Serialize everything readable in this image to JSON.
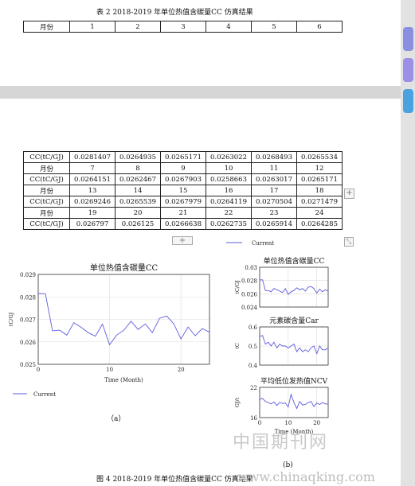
{
  "doc": {
    "table_title": "表 2  2018-2019 年单位热值含碳量CC 仿真结果",
    "header_row": [
      "月份",
      "1",
      "2",
      "3",
      "4",
      "5",
      "6"
    ],
    "rows": [
      [
        "CC(tC/GJ)",
        "0.0281407",
        "0.0264935",
        "0.0265171",
        "0.0263022",
        "0.0268493",
        "0.0265534"
      ],
      [
        "月份",
        "7",
        "8",
        "9",
        "10",
        "11",
        "12"
      ],
      [
        "CC(tC/GJ)",
        "0.0264151",
        "0.0262467",
        "0.0267903",
        "0.0258663",
        "0.0263017",
        "0.0265171"
      ],
      [
        "月份",
        "13",
        "14",
        "15",
        "16",
        "17",
        "18"
      ],
      [
        "CC(tC/GJ)",
        "0.0269246",
        "0.0265539",
        "0.0267979",
        "0.0264119",
        "0.0270504",
        "0.0271479"
      ],
      [
        "月份",
        "19",
        "20",
        "21",
        "22",
        "23",
        "24"
      ],
      [
        "CC(tC/GJ)",
        "0.026797",
        "0.026125",
        "0.0266638",
        "0.0262735",
        "0.0265914",
        "0.0264285"
      ]
    ],
    "label_a": "（a）",
    "label_b": "(b)",
    "figure_caption": "图 4  2018-2019 年单位热值含碳量CC 仿真结果"
  },
  "ui": {
    "add_handle": "+",
    "resize_handle": "⤡",
    "tab_colors": [
      "#8a8fe0",
      "#9b8fe6",
      "#4aa3df"
    ]
  },
  "watermark": {
    "cn": "中国期刊网",
    "url": "www.chinaqking.com"
  },
  "chart_data": [
    {
      "type": "line",
      "title": "单位热值含碳量CC",
      "xlabel": "Time (Month)",
      "ylabel": "tC/GJ",
      "xlim": [
        0,
        24
      ],
      "ylim": [
        0.025,
        0.029
      ],
      "xticks": [
        0,
        10,
        20
      ],
      "yticks": [
        "0.025",
        "0.026",
        "0.027",
        "0.028",
        "0.029"
      ],
      "series": [
        {
          "name": "Current",
          "color": "#5b5bdc",
          "x": [
            0,
            1,
            2,
            3,
            4,
            5,
            6,
            7,
            8,
            9,
            10,
            11,
            12,
            13,
            14,
            15,
            16,
            17,
            18,
            19,
            20,
            21,
            22,
            23,
            24
          ],
          "values": [
            0.02815,
            0.02814,
            0.02649,
            0.02652,
            0.0263,
            0.02685,
            0.02665,
            0.02641,
            0.02625,
            0.02679,
            0.02587,
            0.0263,
            0.02652,
            0.02692,
            0.02655,
            0.0268,
            0.02641,
            0.02705,
            0.02715,
            0.0268,
            0.02613,
            0.02666,
            0.02627,
            0.02659,
            0.02643
          ]
        }
      ],
      "grid": true,
      "legend": "bottom-left"
    },
    {
      "type": "line",
      "title": "单位热值含碳量CC",
      "ylabel": "tC/GJ",
      "xlim": [
        0,
        24
      ],
      "ylim": [
        0.024,
        0.03
      ],
      "yticks": [
        "0.024",
        "0.026",
        "0.028",
        "0.03"
      ],
      "series": [
        {
          "name": "Current",
          "color": "#5b5bdc",
          "x": [
            0,
            1,
            2,
            3,
            4,
            5,
            6,
            7,
            8,
            9,
            10,
            11,
            12,
            13,
            14,
            15,
            16,
            17,
            18,
            19,
            20,
            21,
            22,
            23,
            24
          ],
          "values": [
            0.0281,
            0.0281,
            0.0265,
            0.0265,
            0.0263,
            0.0268,
            0.0266,
            0.0264,
            0.0262,
            0.0268,
            0.0259,
            0.0263,
            0.0265,
            0.0269,
            0.0266,
            0.0268,
            0.0264,
            0.027,
            0.0271,
            0.0268,
            0.0261,
            0.0267,
            0.0263,
            0.0266,
            0.0264
          ]
        }
      ],
      "grid": true,
      "legend": "top"
    },
    {
      "type": "line",
      "title": "元素碳含量Car",
      "ylabel": "tC",
      "xlim": [
        0,
        24
      ],
      "ylim": [
        0.4,
        0.6
      ],
      "yticks": [
        "0.4",
        "0.5",
        "0.6"
      ],
      "series": [
        {
          "name": "Current",
          "color": "#5b5bdc",
          "x": [
            0,
            1,
            2,
            3,
            4,
            5,
            6,
            7,
            8,
            9,
            10,
            11,
            12,
            13,
            14,
            15,
            16,
            17,
            18,
            19,
            20,
            21,
            22,
            23,
            24
          ],
          "values": [
            0.55,
            0.555,
            0.51,
            0.52,
            0.5,
            0.52,
            0.49,
            0.51,
            0.5,
            0.5,
            0.49,
            0.5,
            0.51,
            0.47,
            0.49,
            0.47,
            0.48,
            0.47,
            0.49,
            0.5,
            0.46,
            0.5,
            0.48,
            0.48,
            0.49
          ]
        }
      ],
      "grid": true
    },
    {
      "type": "line",
      "title": "平均低位发热值NCV",
      "xlabel": "Time (Month)",
      "ylabel": "GJ/t",
      "xlim": [
        0,
        24
      ],
      "ylim": [
        16,
        22
      ],
      "xticks": [
        0,
        10,
        20
      ],
      "yticks": [
        "16",
        "22"
      ],
      "series": [
        {
          "name": "Current",
          "color": "#5b5bdc",
          "x": [
            0,
            1,
            2,
            3,
            4,
            5,
            6,
            7,
            8,
            9,
            10,
            11,
            12,
            13,
            14,
            15,
            16,
            17,
            18,
            19,
            20,
            21,
            22,
            23,
            24
          ],
          "values": [
            19.6,
            19.8,
            19.2,
            19.0,
            18.7,
            19.1,
            18.4,
            19.0,
            18.8,
            18.9,
            18.1,
            20.6,
            19.0,
            17.8,
            19.2,
            18.5,
            18.6,
            19.0,
            19.2,
            18.2,
            18.9,
            18.6,
            19.0,
            18.7,
            18.7
          ]
        }
      ],
      "grid": true
    }
  ]
}
